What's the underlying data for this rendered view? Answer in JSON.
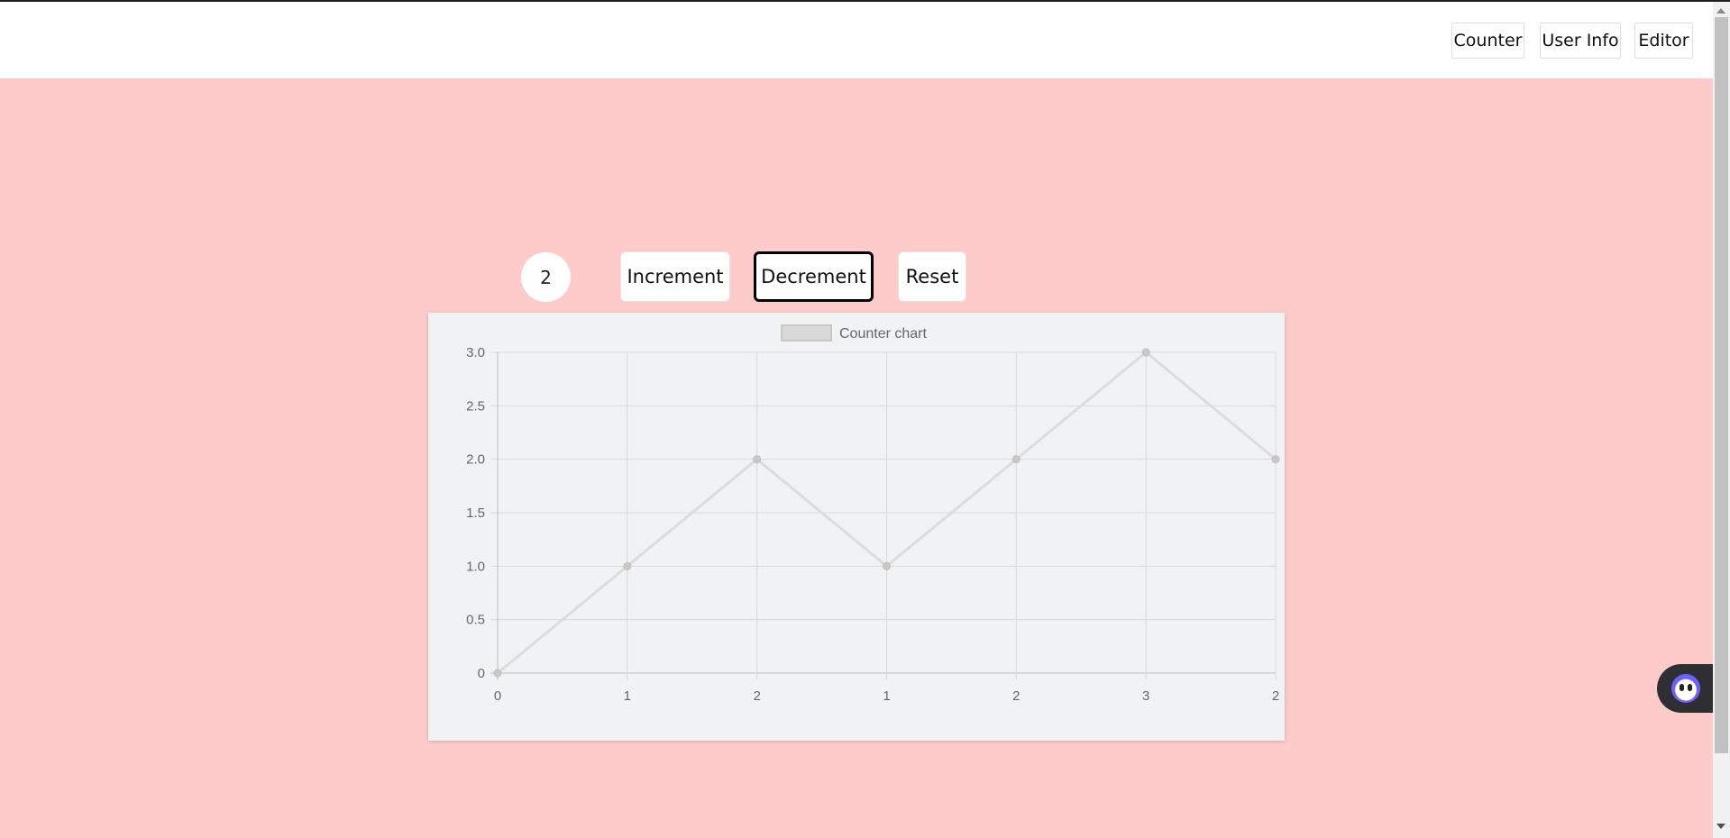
{
  "nav": {
    "items": [
      {
        "label": "Counter"
      },
      {
        "label": "User Info"
      },
      {
        "label": "Editor"
      }
    ]
  },
  "counter": {
    "value": "2",
    "buttons": {
      "increment": "Increment",
      "decrement": "Decrement",
      "reset": "Reset"
    }
  },
  "colors": {
    "header_bg": "#ffffff",
    "page_bg": "#fecbcb",
    "chart_bg": "#f1f2f4",
    "series_line": "#dcdcdc",
    "series_point": "#c8c8c8"
  },
  "chart_data": {
    "type": "line",
    "title": "",
    "categories": [
      "0",
      "1",
      "2",
      "1",
      "2",
      "3",
      "2"
    ],
    "series": [
      {
        "name": "Counter chart",
        "values": [
          0,
          1,
          2,
          1,
          2,
          3,
          2
        ]
      }
    ],
    "ylim": [
      0,
      3
    ],
    "yticks": [
      "0",
      "0.5",
      "1.0",
      "1.5",
      "2.0",
      "2.5",
      "3.0"
    ],
    "xlabel": "",
    "ylabel": "",
    "grid": true,
    "legend": "top-center"
  }
}
